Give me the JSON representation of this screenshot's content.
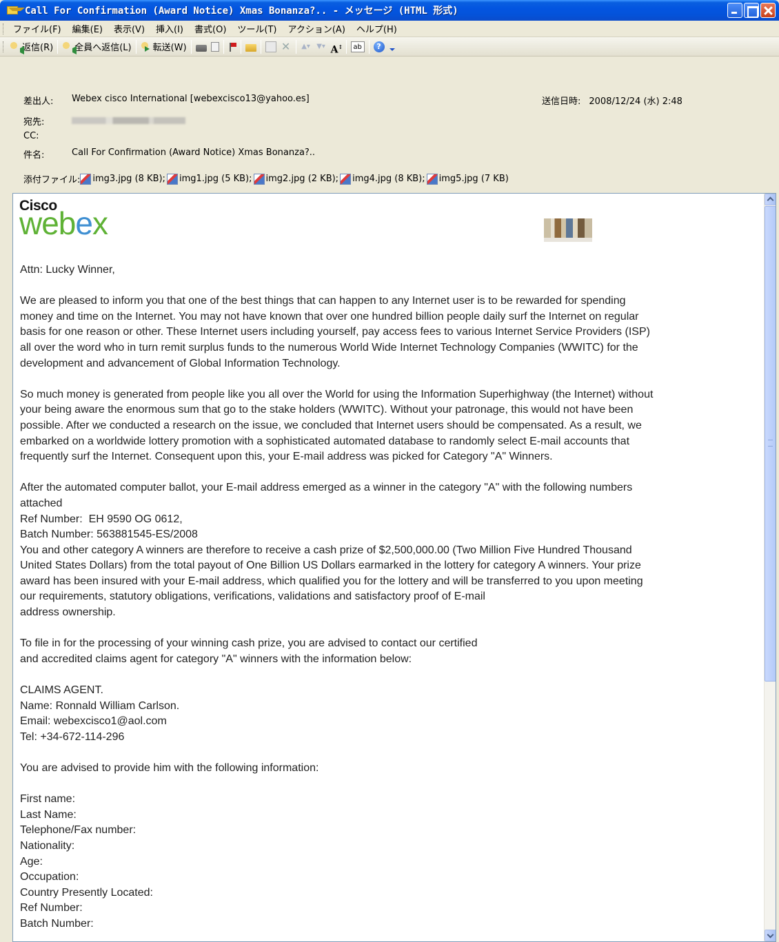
{
  "window": {
    "title": "Call For Confirmation (Award Notice) Xmas Bonanza?.. - メッセージ (HTML 形式)"
  },
  "menu": [
    "ファイル(F)",
    "編集(E)",
    "表示(V)",
    "挿入(I)",
    "書式(O)",
    "ツール(T)",
    "アクション(A)",
    "ヘルプ(H)"
  ],
  "toolbar": {
    "reply": "返信(R)",
    "reply_all": "全員へ返信(L)",
    "forward": "転送(W)"
  },
  "header": {
    "from_label": "差出人:",
    "from_value": "Webex cisco International [webexcisco13@yahoo.es]",
    "sent_label": "送信日時:",
    "sent_value": "2008/12/24 (水) 2:48",
    "to_label": "宛先:",
    "cc_label": "CC:",
    "subject_label": "件名:",
    "subject_value": "Call For Confirmation (Award Notice) Xmas Bonanza?..",
    "attachments_label": "添付ファイル:",
    "attachments": [
      {
        "name": "img3.jpg (8 KB);"
      },
      {
        "name": "img1.jpg (5 KB);"
      },
      {
        "name": "img2.jpg (2 KB);"
      },
      {
        "name": "img4.jpg (8 KB);"
      },
      {
        "name": "img5.jpg (7 KB)"
      }
    ]
  },
  "logo": {
    "cisco": "Cisco",
    "webex_a": "web",
    "webex_b": "e",
    "webex_c": "x"
  },
  "body": {
    "greeting": "Attn:  Lucky Winner,",
    "p1": "We are pleased to inform you that one of the best things that can happen to any Internet user is to be rewarded for spending\nmoney and time on the Internet. You may not have known that over one hundred billion people daily surf the Internet on regular\nbasis for one reason or other. These Internet users including yourself, pay access fees to various Internet Service Providers (ISP)\nall over the word who in turn remit surplus funds to the numerous World Wide Internet Technology Companies (WWITC) for the\ndevelopment and advancement of Global Information Technology.",
    "p2": "So much money is generated from people like you all over the World for using the Information Superhighway (the Internet) without\nyour being aware the enormous sum that go to the stake holders (WWITC). Without your patronage, this would not have been\npossible. After we conducted a research on the issue, we concluded that Internet users should be compensated. As a result, we\nembarked on a worldwide lottery promotion with a sophisticated automated database to randomly select E-mail accounts that\nfrequently surf the Internet. Consequent upon this, your E-mail address was picked for Category \"A\" Winners.",
    "p3": "After the automated computer ballot, your E-mail address emerged as a winner in the category \"A\" with the following numbers\nattached",
    "ref": "Ref Number:  EH 9590 OG 0612,",
    "batch": "Batch Number: 563881545-ES/2008",
    "p4": "You and other category A winners are therefore to receive a cash prize of $2,500,000.00 (Two Million Five Hundred Thousand\nUnited States Dollars) from the total payout of One Billion US Dollars earmarked in the lottery for category A winners. Your prize\naward has been insured with your E-mail address, which qualified you for the lottery and will be transferred to you upon meeting\nour requirements, statutory obligations, verifications, validations and satisfactory proof of E-mail\naddress ownership.",
    "p5": "To file in for the processing of your winning cash prize, you are advised to contact our certified\nand accredited claims agent for category \"A\" winners with the information below:",
    "agent": "CLAIMS AGENT.\nName: Ronnald William Carlson.\nEmail: webexcisco1@aol.com\nTel: +34-672-114-296",
    "p6": "You are advised to provide him with the following information:",
    "fields": "First name:\nLast Name:\nTelephone/Fax number:\nNationality:\nAge:\nOccupation:\nCountry Presently Located:\nRef Number:\nBatch Number:"
  }
}
